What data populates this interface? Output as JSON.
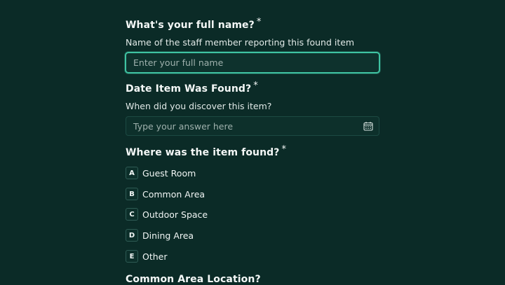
{
  "questions": {
    "full_name": {
      "title": "What's your full name?",
      "required_mark": "*",
      "description": "Name of the staff member reporting this found item",
      "placeholder": "Enter your full name"
    },
    "date_found": {
      "title": "Date Item Was Found?",
      "required_mark": "*",
      "description": "When did you discover this item?",
      "placeholder": "Type your answer here",
      "icon": "calendar-icon"
    },
    "location": {
      "title": "Where was the item found?",
      "required_mark": "*",
      "choices": [
        {
          "key": "A",
          "label": "Guest Room"
        },
        {
          "key": "B",
          "label": "Common Area"
        },
        {
          "key": "C",
          "label": "Outdoor Space"
        },
        {
          "key": "D",
          "label": "Dining Area"
        },
        {
          "key": "E",
          "label": "Other"
        }
      ]
    },
    "common_area": {
      "title": "Common Area Location?"
    }
  },
  "colors": {
    "background": "#0b2b27",
    "focus_border": "#3fc3a2",
    "text": "#f1f5f4"
  }
}
